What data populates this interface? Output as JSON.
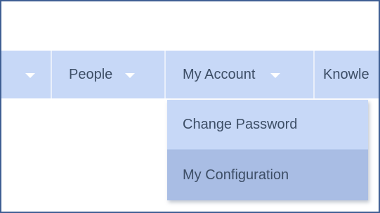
{
  "nav": {
    "items": [
      {
        "label": ""
      },
      {
        "label": "People"
      },
      {
        "label": "My Account"
      },
      {
        "label": "Knowle"
      }
    ]
  },
  "dropdown": {
    "items": [
      {
        "label": "Change Password"
      },
      {
        "label": "My Configuration"
      }
    ]
  },
  "colors": {
    "nav_bg": "#c7d8f7",
    "hover_bg": "#a9bde4",
    "text": "#3d4e66",
    "frame_border": "#3f5f94"
  }
}
